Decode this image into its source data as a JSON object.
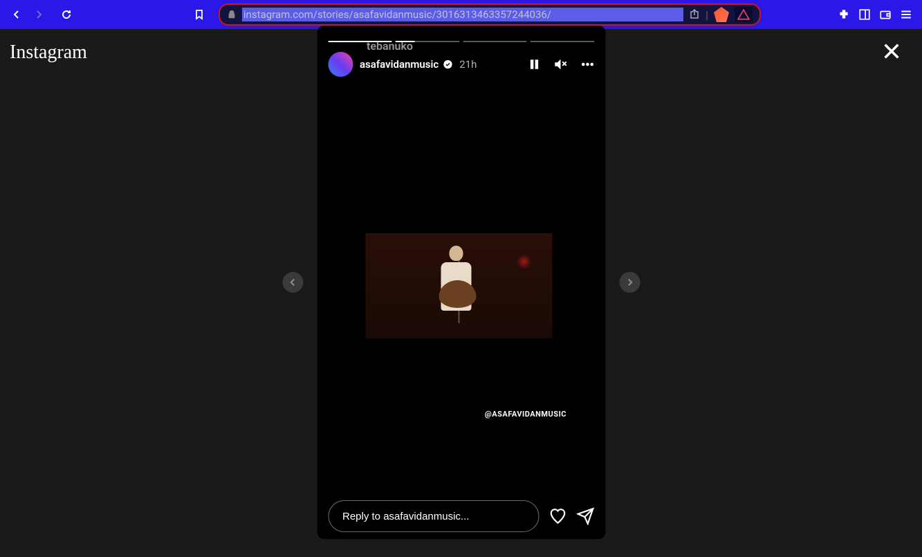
{
  "browser": {
    "url": "instagram.com/stories/asafavidanmusic/3016313463357244036/"
  },
  "app": {
    "logo": "Instagram"
  },
  "story": {
    "overlay_name": "tebanuko",
    "username": "asafavidanmusic",
    "timestamp": "21h",
    "watermark": "@asafavidanmusic",
    "reply_placeholder": "Reply to asafavidanmusic...",
    "segments": 4,
    "active_segment": 1
  }
}
